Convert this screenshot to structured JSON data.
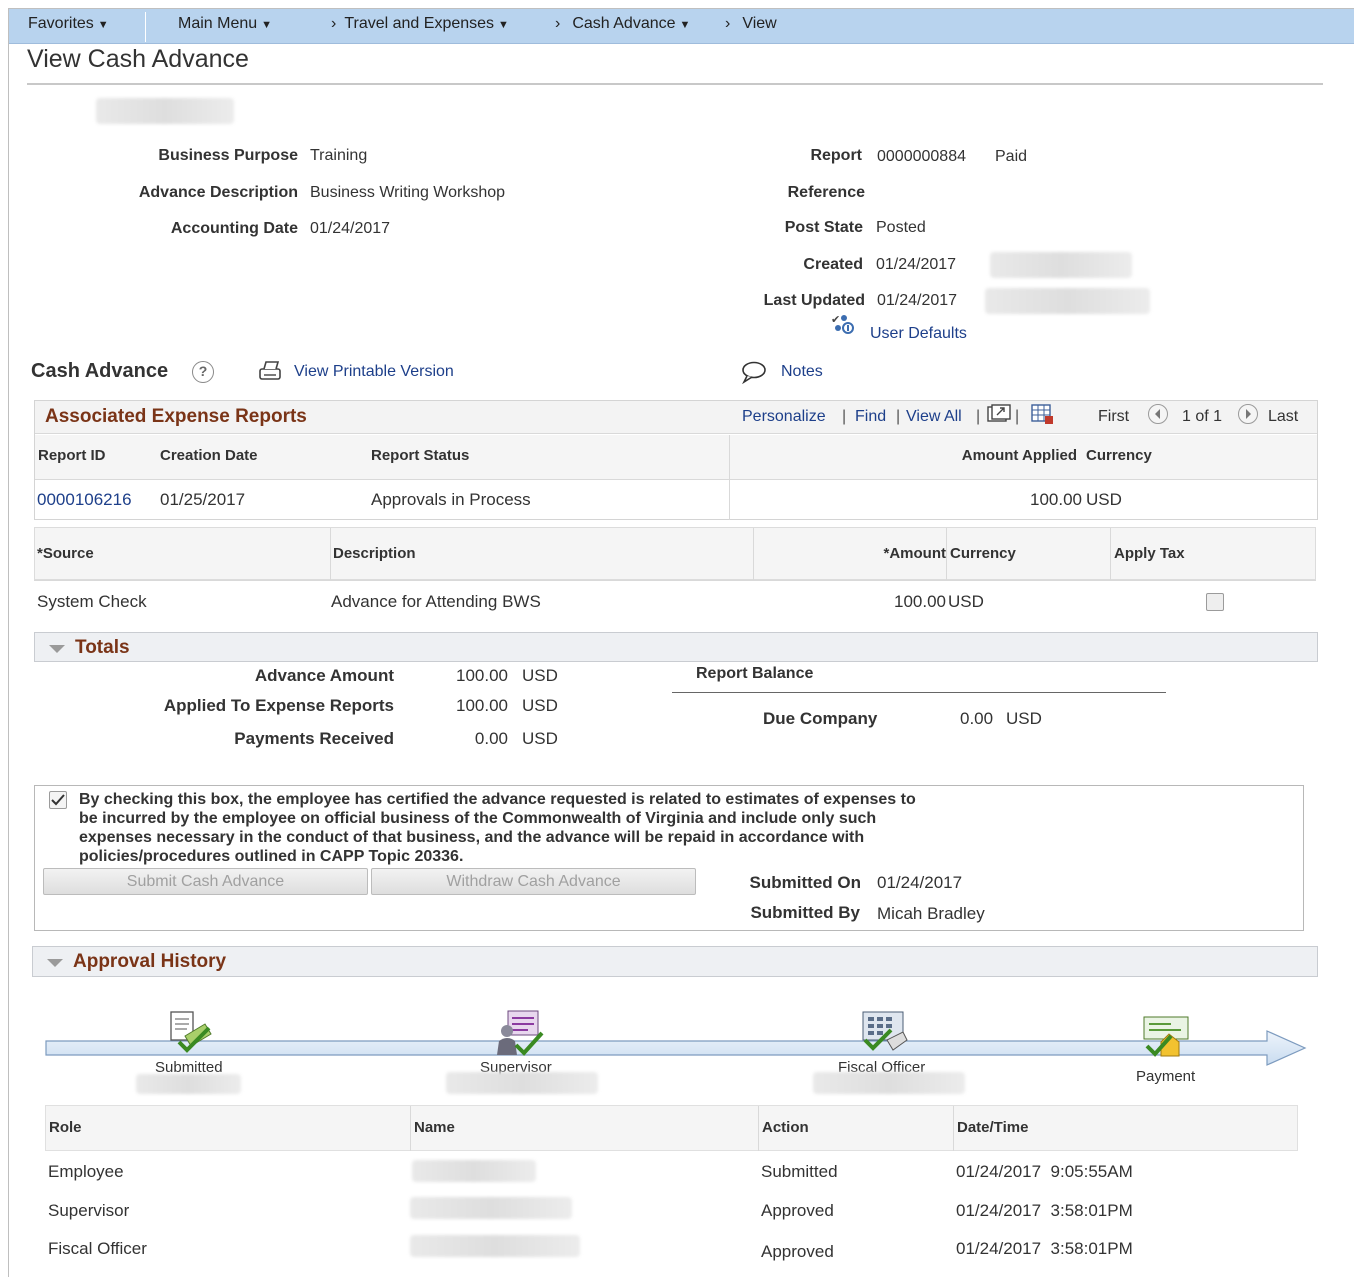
{
  "nav": {
    "favorites": "Favorites",
    "main_menu": "Main Menu",
    "crumb1": "Travel and Expenses",
    "crumb2": "Cash Advance",
    "crumb3": "View"
  },
  "page_title": "View Cash Advance",
  "header_left": {
    "business_purpose_label": "Business Purpose",
    "business_purpose": "Training",
    "advance_description_label": "Advance Description",
    "advance_description": "Business Writing Workshop",
    "accounting_date_label": "Accounting Date",
    "accounting_date": "01/24/2017"
  },
  "header_right": {
    "report_label": "Report",
    "report_id": "0000000884",
    "report_status": "Paid",
    "reference_label": "Reference",
    "post_state_label": "Post State",
    "post_state": "Posted",
    "created_label": "Created",
    "created": "01/24/2017",
    "last_updated_label": "Last Updated",
    "last_updated": "01/24/2017",
    "user_defaults": "User Defaults"
  },
  "cash_advance": {
    "heading": "Cash Advance",
    "printable": "View Printable Version",
    "notes": "Notes"
  },
  "assoc": {
    "title": "Associated Expense Reports",
    "personalize": "Personalize",
    "find": "Find",
    "view_all": "View All",
    "first": "First",
    "pager": "1 of 1",
    "last": "Last",
    "pipe": "|",
    "columns": [
      "Report ID",
      "Creation Date",
      "Report Status",
      "Amount Applied",
      "Currency"
    ],
    "row": {
      "report_id": "0000106216",
      "creation_date": "01/25/2017",
      "status": "Approvals in Process",
      "amount": "100.00",
      "currency": "USD"
    }
  },
  "source_grid": {
    "columns": [
      "*Source",
      "Description",
      "*Amount",
      "Currency",
      "Apply Tax"
    ],
    "row": {
      "source": "System Check",
      "description": "Advance for Attending BWS",
      "amount": "100.00",
      "currency": "USD"
    }
  },
  "totals": {
    "title": "Totals",
    "advance_amount_label": "Advance Amount",
    "advance_amount": "100.00",
    "applied_label": "Applied To Expense Reports",
    "applied": "100.00",
    "payments_label": "Payments Received",
    "payments": "0.00",
    "currency": "USD",
    "report_balance_label": "Report Balance",
    "due_company_label": "Due Company",
    "due_company": "0.00"
  },
  "certify": {
    "line1": "By checking this box, the employee has certified the advance requested is related to estimates of expenses to",
    "line2": "be incurred by the employee on official business of the Commonwealth of Virginia and include only such",
    "line3": "expenses necessary in the conduct of that business, and the advance will be repaid in accordance with",
    "line4": "policies/procedures outlined in CAPP Topic 20336.",
    "submit_btn": "Submit Cash Advance",
    "withdraw_btn": "Withdraw Cash Advance",
    "submitted_on_label": "Submitted On",
    "submitted_on": "01/24/2017",
    "submitted_by_label": "Submitted By",
    "submitted_by": "Micah Bradley"
  },
  "approval": {
    "title": "Approval History",
    "steps": [
      "Submitted",
      "Supervisor",
      "Fiscal Officer",
      "Payment"
    ],
    "columns": [
      "Role",
      "Name",
      "Action",
      "Date/Time"
    ],
    "rows": [
      {
        "role": "Employee",
        "action": "Submitted",
        "datetime": "01/24/2017  9:05:55AM"
      },
      {
        "role": "Supervisor",
        "action": "Approved",
        "datetime": "01/24/2017  3:58:01PM"
      },
      {
        "role": "Fiscal Officer",
        "action": "Approved",
        "datetime": "01/24/2017  3:58:01PM"
      }
    ]
  }
}
